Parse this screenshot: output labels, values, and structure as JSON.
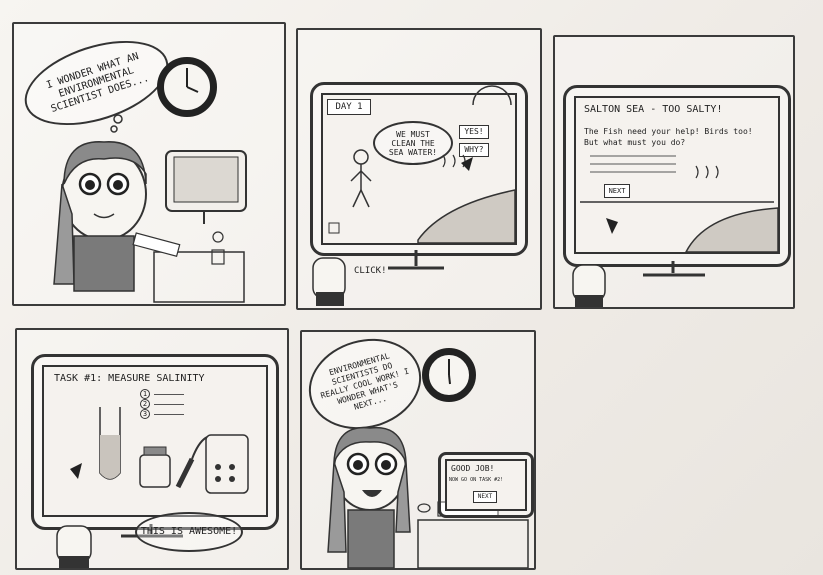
{
  "panel1": {
    "thought": "I WONDER WHAT AN ENVIRONMENTAL SCIENTIST DOES..."
  },
  "panel2": {
    "day_label": "DAY 1",
    "speech": "WE MUST CLEAN THE SEA WATER!",
    "yes_button": "YES!",
    "why_button": "WHY?",
    "click_text": "CLICK!"
  },
  "panel3": {
    "title": "SALTON SEA - TOO SALTY!",
    "body": "The Fish need your help! Birds too! But what must you do?",
    "next_button": "NEXT"
  },
  "panel4": {
    "title": "TASK #1: MEASURE SALINITY",
    "steps": [
      "1",
      "2",
      "3"
    ],
    "meter_reading": "000",
    "speech": "THIS IS AWESOME!"
  },
  "panel5": {
    "speech": "ENVIRONMENTAL SCIENTISTS DO REALLY COOL WORK! I WONDER WHAT'S NEXT...",
    "screen_title": "GOOD JOB!",
    "screen_sub": "NOW GO ON TASK #2!",
    "next_button": "NEXT"
  }
}
